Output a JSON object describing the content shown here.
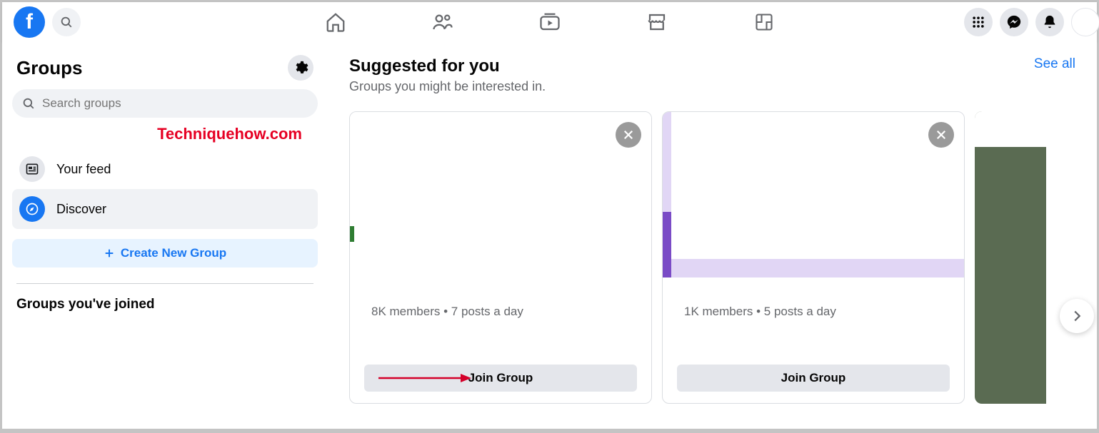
{
  "topnav": {
    "logo_letter": "f"
  },
  "sidebar": {
    "title": "Groups",
    "search_placeholder": "Search groups",
    "watermark": "Techniquehow.com",
    "items": [
      {
        "label": "Your feed"
      },
      {
        "label": "Discover"
      }
    ],
    "create_label": "Create New Group",
    "joined_title": "Groups you've joined"
  },
  "main": {
    "title": "Suggested for you",
    "subtitle": "Groups you might be interested in.",
    "see_all": "See all",
    "cards": [
      {
        "meta": "8K members • 7 posts a day",
        "join_label": "Join Group"
      },
      {
        "meta": "1K members • 5 posts a day",
        "join_label": "Join Group"
      }
    ]
  }
}
